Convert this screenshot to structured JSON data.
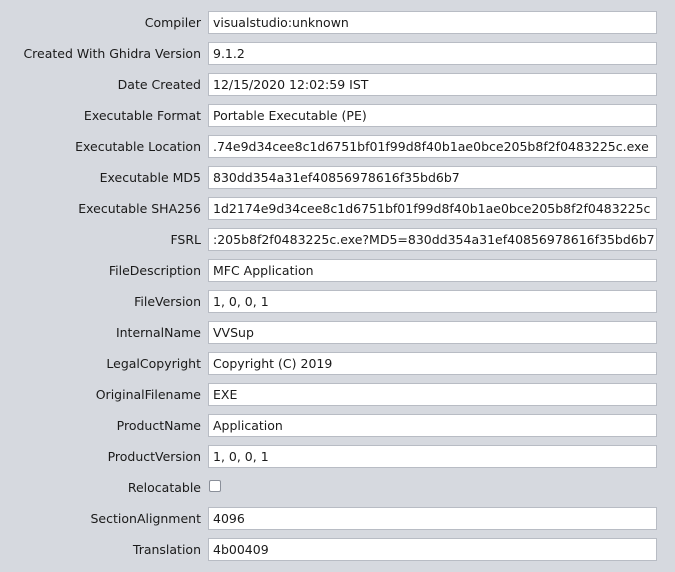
{
  "properties": [
    {
      "label": "Compiler",
      "value": "visualstudio:unknown"
    },
    {
      "label": "Created With Ghidra Version",
      "value": "9.1.2"
    },
    {
      "label": "Date Created",
      "value": "12/15/2020 12:02:59 IST"
    },
    {
      "label": "Executable Format",
      "value": "Portable Executable (PE)"
    },
    {
      "label": "Executable Location",
      "value": ".74e9d34cee8c1d6751bf01f99d8f40b1ae0bce205b8f2f0483225c.exe"
    },
    {
      "label": "Executable MD5",
      "value": "830dd354a31ef40856978616f35bd6b7"
    },
    {
      "label": "Executable SHA256",
      "value": "1d2174e9d34cee8c1d6751bf01f99d8f40b1ae0bce205b8f2f0483225c"
    },
    {
      "label": "FSRL",
      "value": ":205b8f2f0483225c.exe?MD5=830dd354a31ef40856978616f35bd6b7"
    },
    {
      "label": "FileDescription",
      "value": "MFC Application"
    },
    {
      "label": "FileVersion",
      "value": "1, 0, 0, 1"
    },
    {
      "label": "InternalName",
      "value": "VVSup"
    },
    {
      "label": "LegalCopyright",
      "value": "Copyright (C) 2019"
    },
    {
      "label": "OriginalFilename",
      "value": "EXE"
    },
    {
      "label": "ProductName",
      "value": "Application"
    },
    {
      "label": "ProductVersion",
      "value": "1, 0, 0, 1"
    },
    {
      "label": "Relocatable",
      "checked": false
    },
    {
      "label": "SectionAlignment",
      "value": "4096"
    },
    {
      "label": "Translation",
      "value": "4b00409"
    }
  ]
}
